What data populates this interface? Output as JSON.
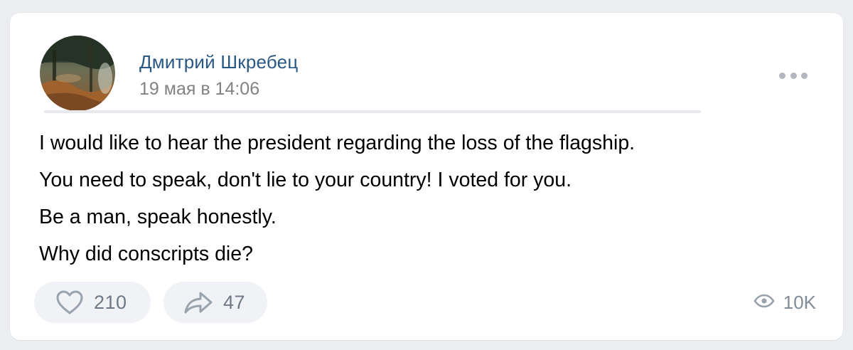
{
  "post": {
    "author": "Дмитрий Шкребец",
    "date": "19 мая в 14:06",
    "lines": [
      "I would like to hear the president regarding the loss of the flagship.",
      "You need to speak, don't lie to your country! I voted for you.",
      "Be a man, speak honestly.",
      "Why did conscripts die?"
    ]
  },
  "actions": {
    "likes": "210",
    "shares": "47",
    "views": "10K"
  },
  "icons": {
    "like": "heart-icon",
    "share": "share-arrow-icon",
    "views": "eye-icon",
    "more": "more-dots-icon"
  },
  "colors": {
    "author": "#2a5885",
    "muted": "#828282",
    "action_bg": "#f0f2f5",
    "action_icon": "#99a2ad"
  }
}
